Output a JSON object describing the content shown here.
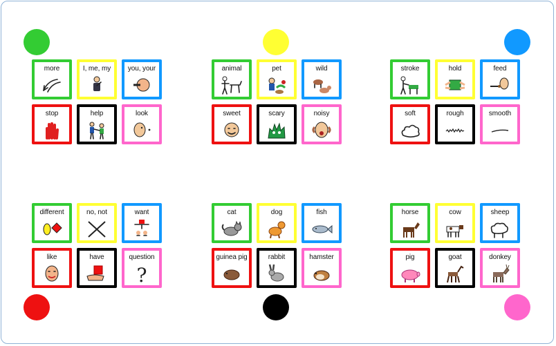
{
  "colors": {
    "green": "#33cc33",
    "yellow": "#ffff33",
    "blue": "#1199ff",
    "red": "#ee1111",
    "black": "#000000",
    "pink": "#ff66cc"
  },
  "dots": [
    {
      "name": "green-dot",
      "color": "#33cc33"
    },
    {
      "name": "yellow-dot",
      "color": "#ffff33"
    },
    {
      "name": "blue-dot",
      "color": "#1199ff"
    },
    {
      "name": "red-dot",
      "color": "#ee1111"
    },
    {
      "name": "black-dot",
      "color": "#000000"
    },
    {
      "name": "pink-dot",
      "color": "#ff66cc"
    }
  ],
  "groups": [
    {
      "name": "core-words-top",
      "cards": [
        {
          "label": "more",
          "border": "green",
          "icon": "more-arrow-icon"
        },
        {
          "label": "I, me, my",
          "border": "yellow",
          "icon": "person-self-icon"
        },
        {
          "label": "you, your",
          "border": "blue",
          "icon": "pointing-hand-icon"
        },
        {
          "label": "stop",
          "border": "red",
          "icon": "stop-hand-icon"
        },
        {
          "label": "help",
          "border": "black",
          "icon": "helping-people-icon"
        },
        {
          "label": "look",
          "border": "pink",
          "icon": "looking-face-icon"
        }
      ]
    },
    {
      "name": "describing-animals",
      "cards": [
        {
          "label": "animal",
          "border": "green",
          "icon": "person-dog-icon"
        },
        {
          "label": "pet",
          "border": "yellow",
          "icon": "pets-icon"
        },
        {
          "label": "wild",
          "border": "blue",
          "icon": "wild-animals-icon"
        },
        {
          "label": "sweet",
          "border": "red",
          "icon": "sweet-face-icon"
        },
        {
          "label": "scary",
          "border": "black",
          "icon": "scary-monster-icon"
        },
        {
          "label": "noisy",
          "border": "pink",
          "icon": "noisy-face-icon"
        }
      ]
    },
    {
      "name": "touching-animals",
      "cards": [
        {
          "label": "stroke",
          "border": "green",
          "icon": "stroking-dog-icon"
        },
        {
          "label": "hold",
          "border": "yellow",
          "icon": "holding-hands-icon"
        },
        {
          "label": "feed",
          "border": "blue",
          "icon": "feeding-icon"
        },
        {
          "label": "soft",
          "border": "red",
          "icon": "soft-cloud-icon"
        },
        {
          "label": "rough",
          "border": "black",
          "icon": "rough-line-icon"
        },
        {
          "label": "smooth",
          "border": "pink",
          "icon": "smooth-line-icon"
        }
      ]
    },
    {
      "name": "core-words-bottom",
      "cards": [
        {
          "label": "different",
          "border": "green",
          "icon": "different-shapes-icon"
        },
        {
          "label": "no, not",
          "border": "yellow",
          "icon": "cross-icon"
        },
        {
          "label": "want",
          "border": "blue",
          "icon": "want-icon"
        },
        {
          "label": "like",
          "border": "red",
          "icon": "like-face-icon"
        },
        {
          "label": "have",
          "border": "black",
          "icon": "have-box-icon"
        },
        {
          "label": "question",
          "border": "pink",
          "icon": "question-mark-icon"
        }
      ]
    },
    {
      "name": "small-pets",
      "cards": [
        {
          "label": "cat",
          "border": "green",
          "icon": "cat-icon"
        },
        {
          "label": "dog",
          "border": "yellow",
          "icon": "dog-icon"
        },
        {
          "label": "fish",
          "border": "blue",
          "icon": "fish-icon"
        },
        {
          "label": "guinea pig",
          "border": "red",
          "icon": "guinea-pig-icon"
        },
        {
          "label": "rabbit",
          "border": "black",
          "icon": "rabbit-icon"
        },
        {
          "label": "hamster",
          "border": "pink",
          "icon": "hamster-icon"
        }
      ]
    },
    {
      "name": "farm-animals",
      "cards": [
        {
          "label": "horse",
          "border": "green",
          "icon": "horse-icon"
        },
        {
          "label": "cow",
          "border": "yellow",
          "icon": "cow-icon"
        },
        {
          "label": "sheep",
          "border": "blue",
          "icon": "sheep-icon"
        },
        {
          "label": "pig",
          "border": "red",
          "icon": "pig-icon"
        },
        {
          "label": "goat",
          "border": "black",
          "icon": "goat-icon"
        },
        {
          "label": "donkey",
          "border": "pink",
          "icon": "donkey-icon"
        }
      ]
    }
  ]
}
